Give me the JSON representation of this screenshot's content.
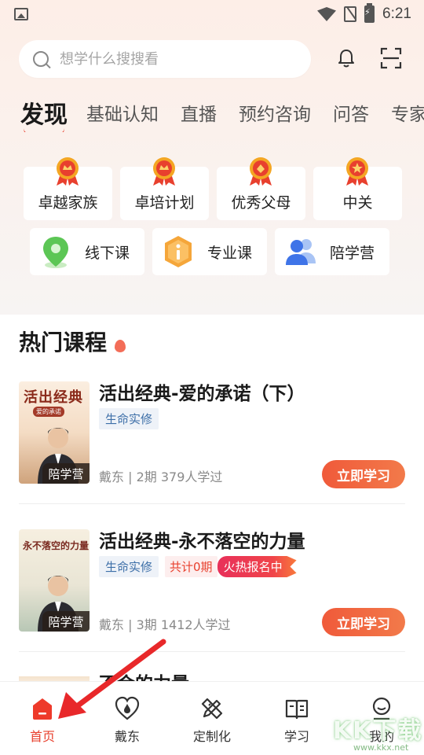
{
  "status_bar": {
    "time": "6:21"
  },
  "search": {
    "placeholder": "想学什么搜搜看"
  },
  "tabs": [
    {
      "label": "发现",
      "active": true
    },
    {
      "label": "基础认知"
    },
    {
      "label": "直播"
    },
    {
      "label": "预约咨询"
    },
    {
      "label": "问答"
    },
    {
      "label": "专家"
    }
  ],
  "honor_items": [
    {
      "label": "卓越家族",
      "icon": "medal-icon"
    },
    {
      "label": "卓培计划",
      "icon": "medal-icon"
    },
    {
      "label": "优秀父母",
      "icon": "medal-icon"
    },
    {
      "label": "中关",
      "icon": "medal-icon"
    }
  ],
  "course_types": [
    {
      "label": "线下课",
      "icon": "location-pin-icon"
    },
    {
      "label": "专业课",
      "icon": "info-hexagon-icon"
    },
    {
      "label": "陪学营",
      "icon": "group-people-icon"
    }
  ],
  "hot_courses": {
    "title": "热门课程",
    "items": [
      {
        "title": "活出经典-爱的承诺（下）",
        "cover_title": "活出经典",
        "cover_subtitle": "爱的承诺",
        "cover_badge": "陪学营",
        "tags": [
          "生命实修"
        ],
        "meta": "戴东 | 2期  379人学过",
        "button": "立即学习"
      },
      {
        "title": "活出经典-永不落空的力量",
        "cover_title": "永不落空的力量",
        "cover_badge": "陪学营",
        "tags": [
          "生命实修"
        ],
        "count_tag": "共计0期",
        "hot_tag": "火热报名中",
        "meta": "戴东 | 3期  1412人学过",
        "button": "立即学习"
      }
    ],
    "partial_title": "不会的力量"
  },
  "bottom_nav": [
    {
      "label": "首页",
      "icon": "home-icon",
      "active": true
    },
    {
      "label": "戴东",
      "icon": "heart-drop-icon"
    },
    {
      "label": "定制化",
      "icon": "pencil-ruler-icon"
    },
    {
      "label": "学习",
      "icon": "book-icon"
    },
    {
      "label": "我的",
      "icon": "profile-icon"
    }
  ],
  "watermark": {
    "text": "KK下载",
    "url": "www.kkx.net"
  },
  "colors": {
    "accent": "#e8402e",
    "button_gradient_start": "#f05a3a",
    "button_gradient_end": "#f27a4a",
    "tag_blue": "#3d6fa8"
  }
}
